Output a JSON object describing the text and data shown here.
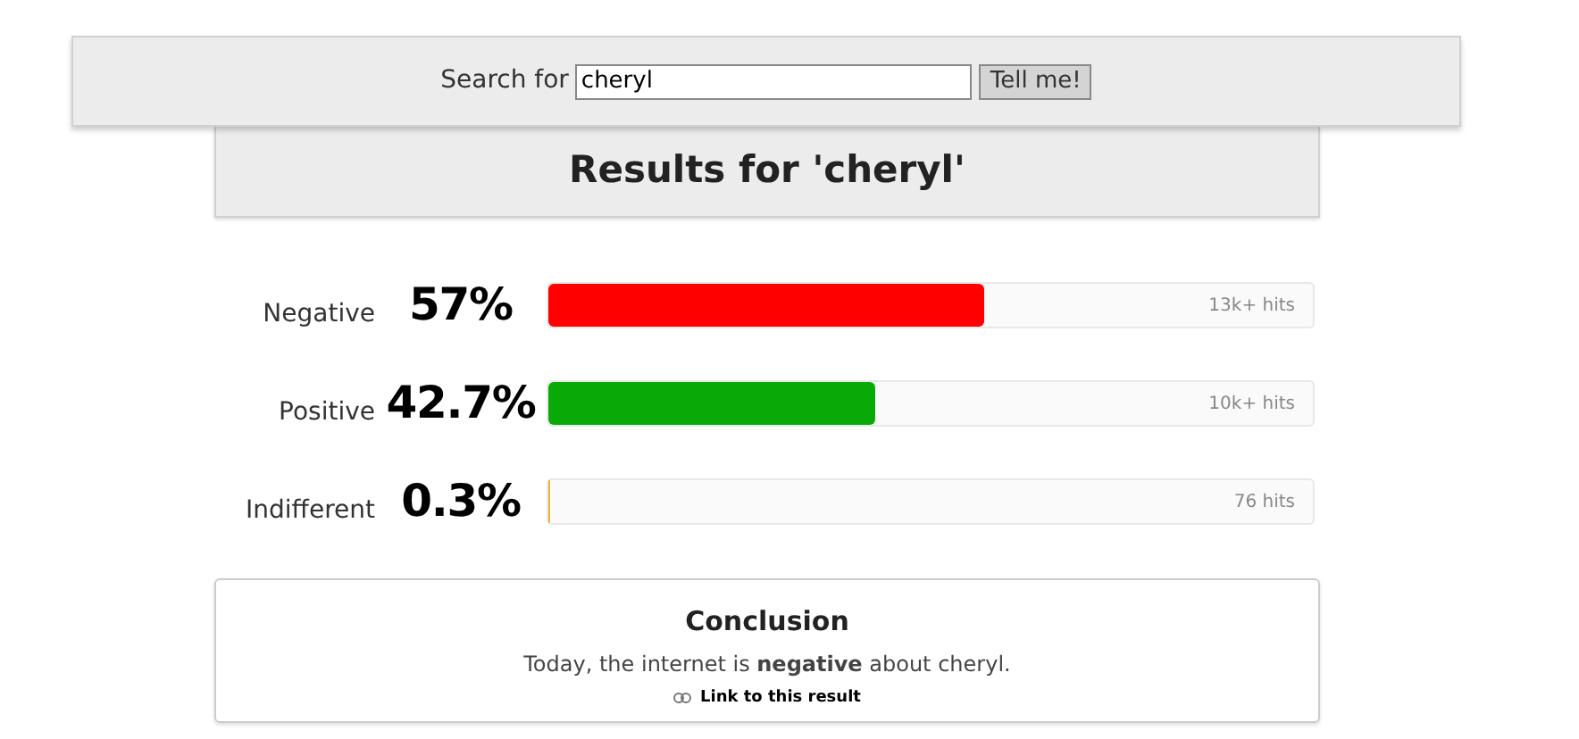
{
  "search": {
    "label": "Search for",
    "value": "cheryl",
    "button": "Tell me!"
  },
  "results_title": "Results for 'cheryl'",
  "sentiments": [
    {
      "label": "Negative",
      "percent": "57%",
      "level": 0.57,
      "color": "#ff0000",
      "hits": "13k+ hits"
    },
    {
      "label": "Positive",
      "percent": "42.7%",
      "level": 0.427,
      "color": "#08aa08",
      "hits": "10k+ hits"
    },
    {
      "label": "Indifferent",
      "percent": "0.3%",
      "level": 0.003,
      "color": "#e8b830",
      "hits": "76 hits"
    }
  ],
  "conclusion": {
    "title": "Conclusion",
    "text": "Today, the internet is **negative** about cheryl.",
    "link": "Link to this result"
  }
}
